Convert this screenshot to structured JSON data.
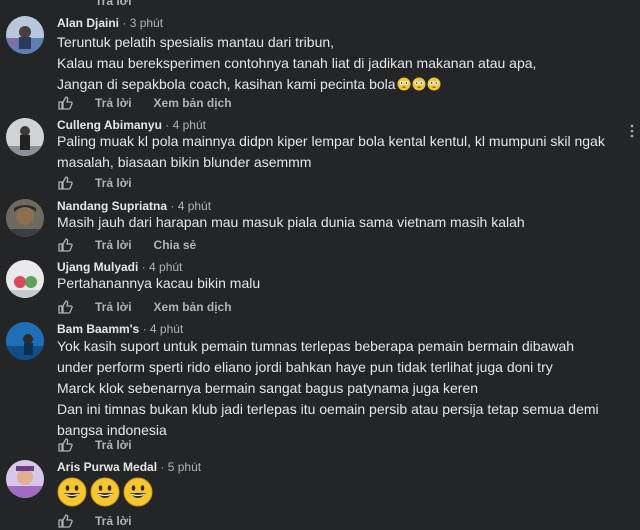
{
  "top": {
    "reply_label": "Trả lời"
  },
  "comments": [
    {
      "author": "Alan Djaini",
      "time": "3 phút",
      "lines": [
        "Teruntuk pelatih spesialis mantau dari tribun,",
        "Kalau mau bereksperimen contohnya tanah liat di jadikan makanan atau apa,",
        "Jangan di sepakbola coach, kasihan kami pecinta bola"
      ],
      "emoji_trail": "😳😳😳",
      "reply_label": "Trả lời",
      "translate_label": "Xem bản dịch",
      "avatar_icon": "profile-photo"
    },
    {
      "author": "Culleng Abimanyu",
      "time": "4 phút",
      "lines": [
        "Paling muak kl pola mainnya didpn kiper lempar bola kental kentul, kl mumpuni skil ngak",
        "masalah, biasaan bikin blunder asemmm"
      ],
      "reply_label": "Trả lời",
      "avatar_icon": "profile-photo"
    },
    {
      "author": "Nandang Supriatna",
      "time": "4 phút",
      "lines": [
        "Masih jauh dari harapan mau masuk piala dunia sama vietnam masih kalah"
      ],
      "reply_label": "Trả lời",
      "share_label": "Chia sẻ",
      "avatar_icon": "profile-photo"
    },
    {
      "author": "Ujang Mulyadi",
      "time": "4 phút",
      "lines": [
        "Pertahanannya kacau bikin malu"
      ],
      "reply_label": "Trả lời",
      "translate_label": "Xem bản dịch",
      "avatar_icon": "profile-photo"
    },
    {
      "author": "Bam Baamm's",
      "time": "4 phút",
      "lines": [
        "Yok kasih suport untuk pemain tumnas terlepas beberapa pemain bermain dibawah",
        "under perform sperti rido eliano jordi bahkan haye pun tidak terlihat juga doni try",
        "Marck klok sebenarnya bermain sangat bagus patynama juga keren",
        "Dan ini timnas bukan klub jadi terlepas itu oemain persib atau persija tetap semua demi",
        "bangsa indonesia"
      ],
      "reply_label": "Trả lời",
      "avatar_icon": "profile-photo"
    },
    {
      "author": "Aris Purwa Medal",
      "time": "5 phút",
      "big_emoji": "😀😀😀",
      "reply_label": "Trả lời",
      "avatar_icon": "profile-photo"
    }
  ],
  "separator": "·",
  "icons": {
    "like": "thumbs-up-icon",
    "more": "more-options-icon"
  },
  "colors": {
    "background": "#242526",
    "text": "#e4e6eb",
    "secondary": "#b0b3b8"
  }
}
